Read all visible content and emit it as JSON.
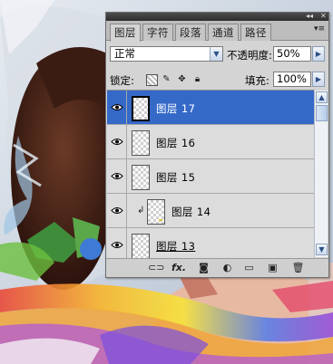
{
  "panel": {
    "tabs": [
      {
        "label": "图层",
        "active": true
      },
      {
        "label": "字符",
        "active": false
      },
      {
        "label": "段落",
        "active": false
      },
      {
        "label": "通道",
        "active": false
      },
      {
        "label": "路径",
        "active": false
      }
    ],
    "blend_mode": "正常",
    "opacity_label": "不透明度:",
    "opacity_value": "50%",
    "lock_label": "锁定:",
    "fill_label": "填充:",
    "fill_value": "100%",
    "layers": [
      {
        "name": "图层 17",
        "selected": true,
        "clipped": false
      },
      {
        "name": "图层 16",
        "selected": false,
        "clipped": false
      },
      {
        "name": "图层 15",
        "selected": false,
        "clipped": false
      },
      {
        "name": "图层 14",
        "selected": false,
        "clipped": true
      },
      {
        "name": "图层 13",
        "selected": false,
        "clipped": false
      }
    ],
    "footer_icons": [
      "link-icon",
      "fx-icon",
      "mask-icon",
      "adjustment-icon",
      "folder-icon",
      "new-layer-icon",
      "trash-icon"
    ],
    "footer_fx": "fx."
  },
  "colors": {
    "selection": "#3569c8",
    "panel_bg": "#d4d4d4",
    "tab_bar": "#bdbdbd"
  }
}
